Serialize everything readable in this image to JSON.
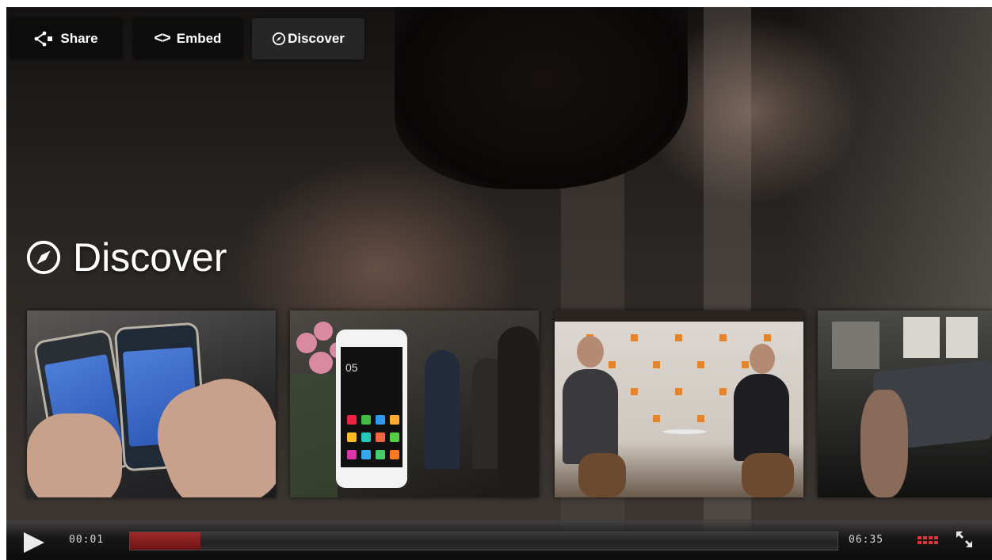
{
  "top_buttons": [
    {
      "label": "Share",
      "icon": "share-icon"
    },
    {
      "label": "Embed",
      "icon": "code-icon",
      "glyph": "<>"
    },
    {
      "label": "Discover",
      "icon": "compass-icon",
      "active": true
    }
  ],
  "discover": {
    "title": "Discover",
    "icon": "compass-icon",
    "thumbnails": [
      {
        "icon": "video-thumbnail"
      },
      {
        "icon": "video-thumbnail",
        "phone_clock": "05"
      },
      {
        "icon": "video-thumbnail"
      },
      {
        "icon": "video-thumbnail"
      }
    ]
  },
  "controls": {
    "current_time": "00:01",
    "total_time": "06:35",
    "progress_fraction": 0.1,
    "accent_color": "#a02a2a",
    "icons": [
      "play-icon",
      "quality-grid-icon",
      "fullscreen-icon"
    ]
  }
}
